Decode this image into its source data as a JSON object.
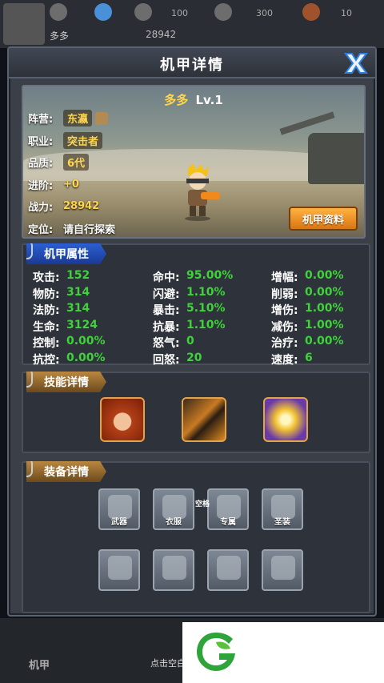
{
  "topbar": {
    "player_name": "多多",
    "power": "28942",
    "res1": "100",
    "res2": "300",
    "res3": "10"
  },
  "modal": {
    "title": "机甲详情"
  },
  "hero": {
    "name": "多多",
    "level": "Lv.1",
    "faction_label": "阵营:",
    "faction": "东瀛",
    "job_label": "职业:",
    "job": "突击者",
    "quality_label": "品质:",
    "quality": "6代",
    "advance_label": "进阶:",
    "advance": "+0",
    "power_label": "战力:",
    "power": "28942",
    "position_label": "定位:",
    "position": "请自行探索",
    "detail_button": "机甲资料"
  },
  "attributes": {
    "title": "机甲属性",
    "col1": [
      {
        "label": "攻击:",
        "value": "152"
      },
      {
        "label": "物防:",
        "value": "314"
      },
      {
        "label": "法防:",
        "value": "314"
      },
      {
        "label": "生命:",
        "value": "3124"
      },
      {
        "label": "控制:",
        "value": "0.00%"
      },
      {
        "label": "抗控:",
        "value": "0.00%"
      }
    ],
    "col2": [
      {
        "label": "命中:",
        "value": "95.00%"
      },
      {
        "label": "闪避:",
        "value": "1.10%"
      },
      {
        "label": "暴击:",
        "value": "5.10%"
      },
      {
        "label": "抗暴:",
        "value": "1.10%"
      },
      {
        "label": "怒气:",
        "value": "0"
      },
      {
        "label": "回怒:",
        "value": "20"
      }
    ],
    "col3": [
      {
        "label": "增幅:",
        "value": "0.00%"
      },
      {
        "label": "削弱:",
        "value": "0.00%"
      },
      {
        "label": "增伤:",
        "value": "1.00%"
      },
      {
        "label": "减伤:",
        "value": "1.00%"
      },
      {
        "label": "治疗:",
        "value": "0.00%"
      },
      {
        "label": "速度:",
        "value": "6"
      }
    ]
  },
  "skills": {
    "title": "技能详情"
  },
  "equipment": {
    "title": "装备详情",
    "slots": [
      "武器",
      "衣服",
      "专属",
      "圣装"
    ],
    "note": "空格"
  },
  "bottom_nav": {
    "tab1": "机甲",
    "hint": "点击空白"
  },
  "colors": {
    "stat_value": "#3fd23a",
    "hero_name": "#ffd54a",
    "button": "#f0961f"
  }
}
